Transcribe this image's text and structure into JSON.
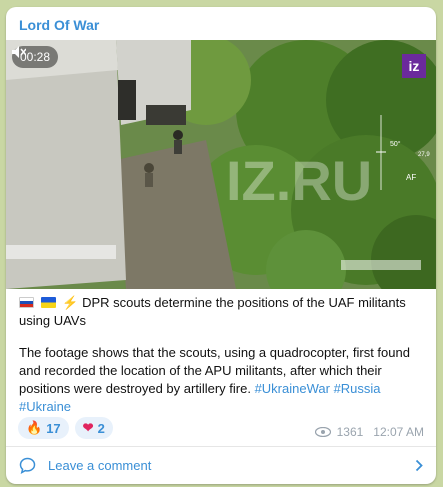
{
  "channel": {
    "name": "Lord Of War"
  },
  "media": {
    "duration": "00:28",
    "logo_text": "iz",
    "watermark": "IZ.RU",
    "hud": {
      "heading": "50°",
      "altitude": "27,9",
      "mode": "AF"
    },
    "icons": [
      "mute-icon"
    ]
  },
  "post": {
    "headline": "DPR scouts determine the positions of the UAF militants using UAVs",
    "body": "The footage shows that the scouts, using a quadrocopter, first found and recorded the location of the APU militants, after which their positions were destroyed by artillery fire.",
    "hashtags": [
      "#UkraineWar",
      "#Russia",
      "#Ukraine"
    ],
    "emojis": [
      "russian-flag",
      "ukrainian-flag",
      "lightning"
    ]
  },
  "reactions": [
    {
      "emoji": "🔥",
      "count": "17"
    },
    {
      "emoji": "❤",
      "count": "2"
    }
  ],
  "meta": {
    "views": "1361",
    "time": "12:07 AM"
  },
  "comment": {
    "label": "Leave a comment"
  },
  "colors": {
    "accent": "#3a8fd6",
    "background": "#c9d7a3",
    "logo": "#6b2a9c"
  }
}
